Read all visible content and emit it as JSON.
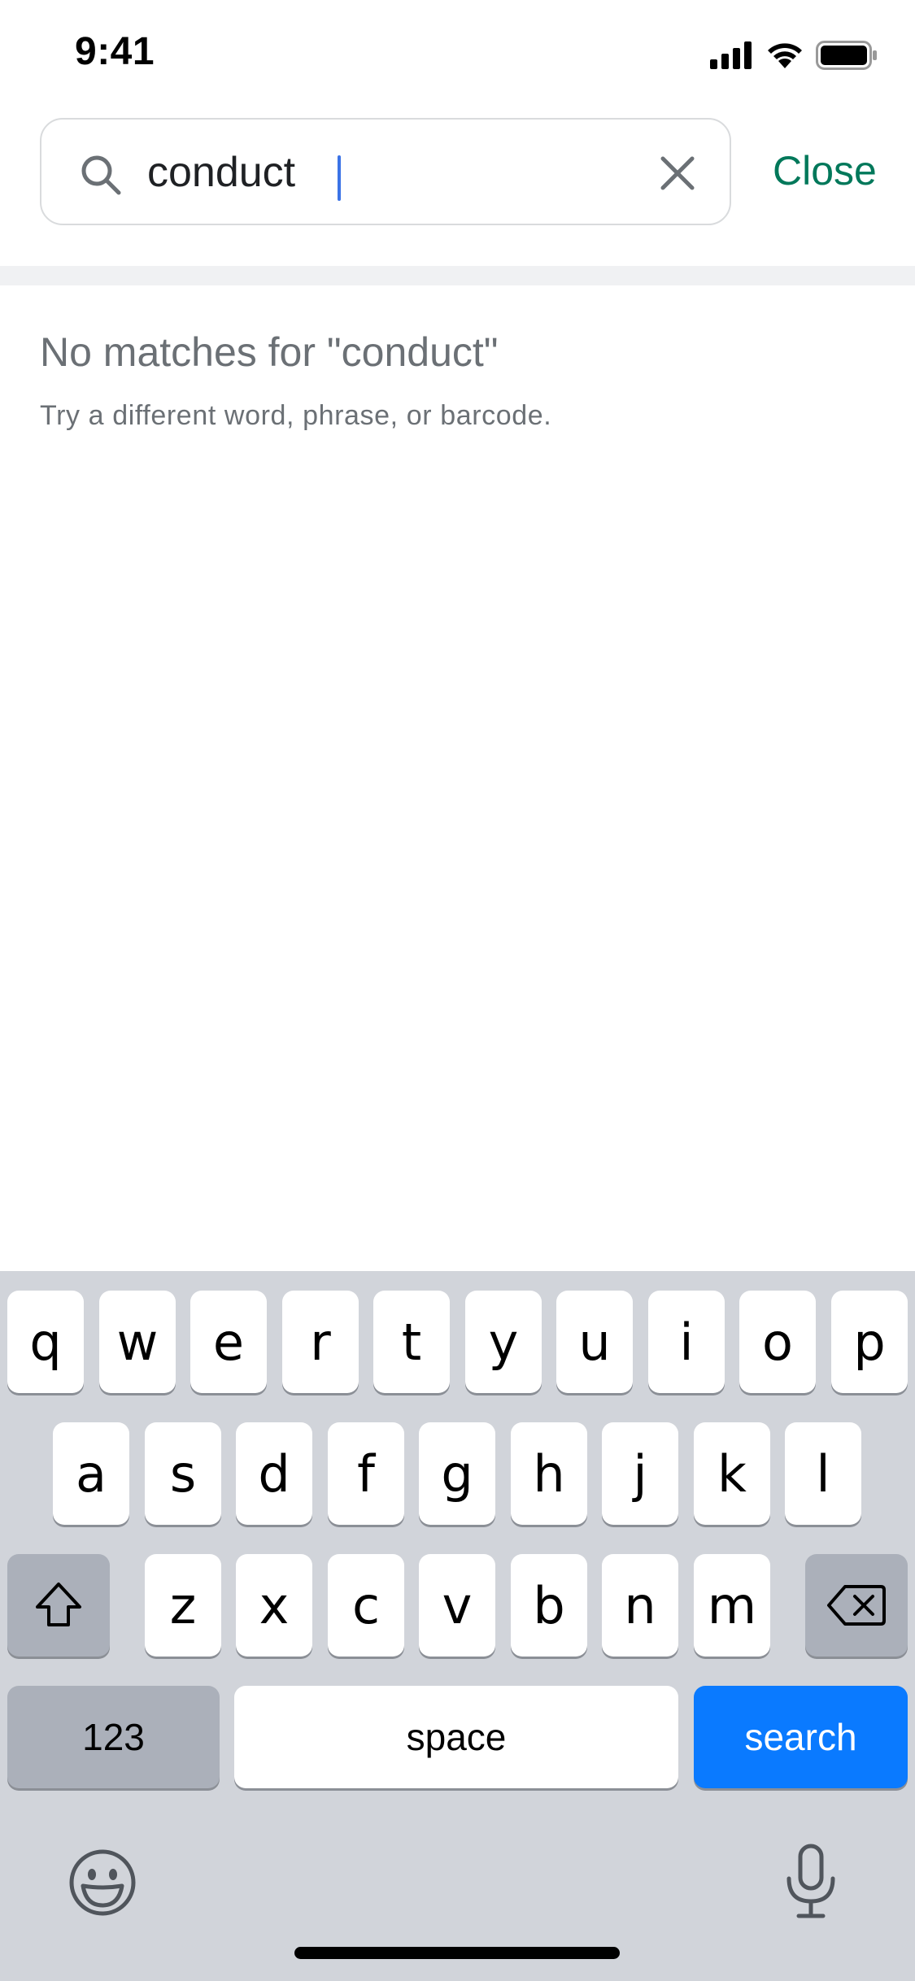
{
  "status_bar": {
    "time": "9:41"
  },
  "search": {
    "query": "conduct",
    "close_label": "Close"
  },
  "empty_state": {
    "title": "No matches for \"conduct\"",
    "subtitle": "Try a different word, phrase, or barcode."
  },
  "keyboard": {
    "row1": [
      "q",
      "w",
      "e",
      "r",
      "t",
      "y",
      "u",
      "i",
      "o",
      "p"
    ],
    "row2": [
      "a",
      "s",
      "d",
      "f",
      "g",
      "h",
      "j",
      "k",
      "l"
    ],
    "row3": [
      "z",
      "x",
      "c",
      "v",
      "b",
      "n",
      "m"
    ],
    "numbers_label": "123",
    "space_label": "space",
    "search_label": "search"
  },
  "colors": {
    "accent_green": "#00785a",
    "keyboard_blue": "#0a7aff",
    "keyboard_bg": "#d1d4da"
  },
  "icons": {
    "status": [
      "signal-icon",
      "wifi-icon",
      "battery-icon"
    ],
    "search": "search-icon",
    "clear": "clear-icon",
    "shift": "shift-icon",
    "delete": "backspace-icon",
    "emoji": "emoji-icon",
    "mic": "microphone-icon"
  }
}
